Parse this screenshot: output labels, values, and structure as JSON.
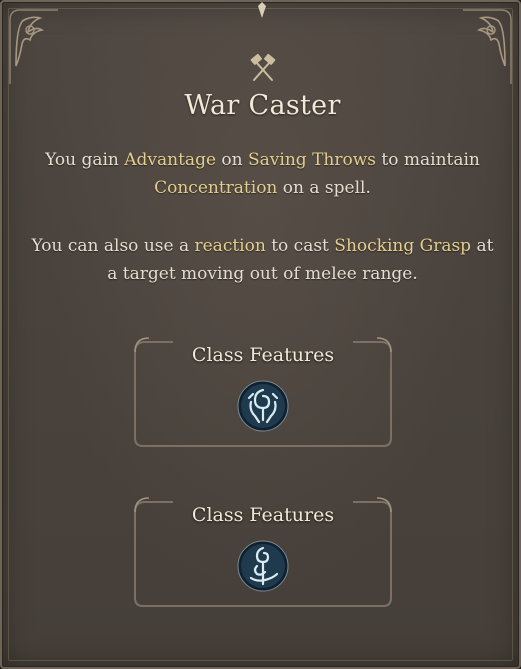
{
  "tooltip": {
    "title": "War Caster",
    "title_icon": "crossed-hammers-icon",
    "paragraph1": {
      "t1": "You gain ",
      "advantage": "Advantage",
      "t2": " on ",
      "saving_throws": "Saving Throws",
      "t3": " to maintain ",
      "concentration": "Concentration",
      "t4": " on a spell."
    },
    "paragraph2": {
      "t1": "You can also use a ",
      "reaction": "reaction",
      "t2": " to cast ",
      "shocking_grasp": "Shocking Grasp",
      "t3": " at a target moving out of melee range."
    },
    "sources": [
      {
        "label": "Class Features",
        "icon": "sorcerer-class-icon"
      },
      {
        "label": "Class Features",
        "icon": "wizard-class-icon"
      }
    ]
  },
  "colors": {
    "panel": "#4a433d",
    "keyword": "#e4cf8e",
    "text": "#e6ddd0",
    "title": "#f1e8d6",
    "icon_bg": "#1f3a4c",
    "icon_glyph": "#d9ecf4"
  }
}
